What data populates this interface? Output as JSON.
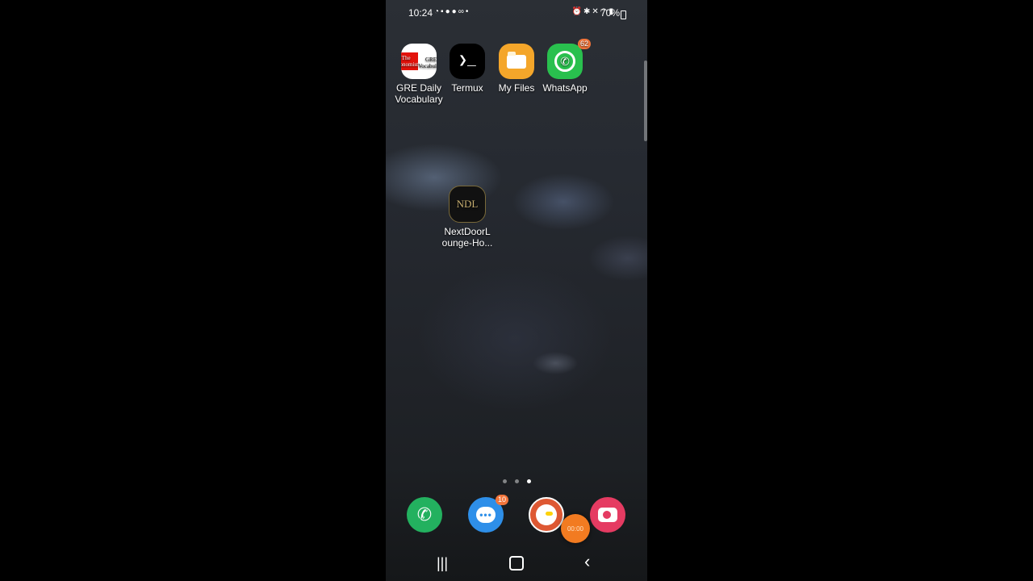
{
  "status_bar": {
    "time": "10:24",
    "notification_icons": [
      "whatsapp-icon",
      "message-icon",
      "facebook-icon",
      "facebook-icon",
      "voicemail-icon",
      "dot-icon"
    ],
    "system_icons": [
      "alarm-icon",
      "bluetooth-icon",
      "mute-icon",
      "wifi-icon",
      "signal-icon"
    ],
    "battery": "70%"
  },
  "home_apps": [
    {
      "label_line1": "GRE Daily",
      "label_line2": "Vocabulary",
      "icon": "gre-vocabulary-icon",
      "icon_top": "The Economist",
      "icon_bottom": "GRE Vocabulary"
    },
    {
      "label_line1": "Termux",
      "icon": "terminal-icon",
      "glyph": "❯_"
    },
    {
      "label_line1": "My Files",
      "icon": "folder-icon"
    },
    {
      "label_line1": "WhatsApp",
      "icon": "whatsapp-icon",
      "badge": "62"
    },
    {
      "label_line1": "NextDoorL",
      "label_line2": "ounge-Ho...",
      "icon": "ndl-icon",
      "glyph": "NDL"
    }
  ],
  "page_indicator": {
    "count": 3,
    "active": 3
  },
  "dock": [
    {
      "icon": "phone-icon"
    },
    {
      "icon": "messages-icon",
      "badge": "10"
    },
    {
      "icon": "duckduckgo-icon"
    },
    {
      "icon": "camera-icon"
    }
  ],
  "recorder_bubble": {
    "text": "00:00"
  },
  "nav_bar": {
    "recents": "|||",
    "back": "‹"
  },
  "colors": {
    "whatsapp": "#29c04e",
    "files": "#f4a62a",
    "badge": "#f2753b",
    "phone": "#23b15f",
    "messages": "#2e8fe9",
    "duckduckgo": "#de5833",
    "camera": "#e53b62",
    "recorder": "#f27b21"
  }
}
